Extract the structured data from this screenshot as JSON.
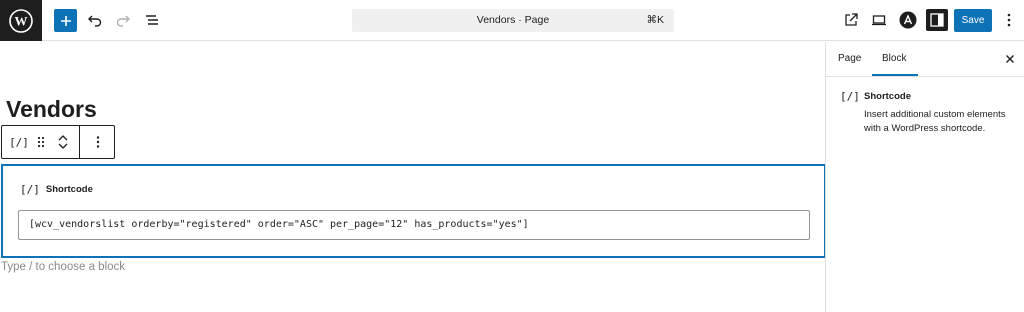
{
  "header": {
    "logo_icon": "wordpress-logo-icon",
    "add_block_icon": "plus-icon",
    "undo_icon": "undo-icon",
    "redo_icon": "redo-icon",
    "list_view_icon": "list-view-icon",
    "document_title": "Vendors · Page",
    "shortcut": "⌘K",
    "view_page_icon": "external-link-icon",
    "preview_icon": "desktop-preview-icon",
    "astra_icon": "astra-logo-icon",
    "settings_icon": "sidebar-toggle-icon",
    "save_label": "Save",
    "options_icon": "vertical-ellipsis-icon"
  },
  "editor": {
    "page_title": "Vendors",
    "block_toolbar": {
      "block_icon": "[/]",
      "drag_icon": "drag-handle-icon",
      "move_up_icon": "chevron-up-icon",
      "move_down_icon": "chevron-down-icon",
      "more_icon": "vertical-ellipsis-icon"
    },
    "shortcode_block": {
      "icon": "[/]",
      "label": "Shortcode",
      "value": "[wcv_vendorslist orderby=\"registered\" order=\"ASC\" per_page=\"12\" has_products=\"yes\"]"
    },
    "appender_placeholder": "Type / to choose a block"
  },
  "sidebar": {
    "tabs": [
      {
        "label": "Page",
        "active": false
      },
      {
        "label": "Block",
        "active": true
      }
    ],
    "close_icon": "close-icon",
    "block_card": {
      "icon": "[/]",
      "title": "Shortcode",
      "description": "Insert additional custom elements with a WordPress shortcode."
    }
  },
  "colors": {
    "accent": "#0d72b6",
    "dark": "#1e1e1e",
    "border": "#e0e0e0",
    "placeholder": "#8a8a8a"
  }
}
